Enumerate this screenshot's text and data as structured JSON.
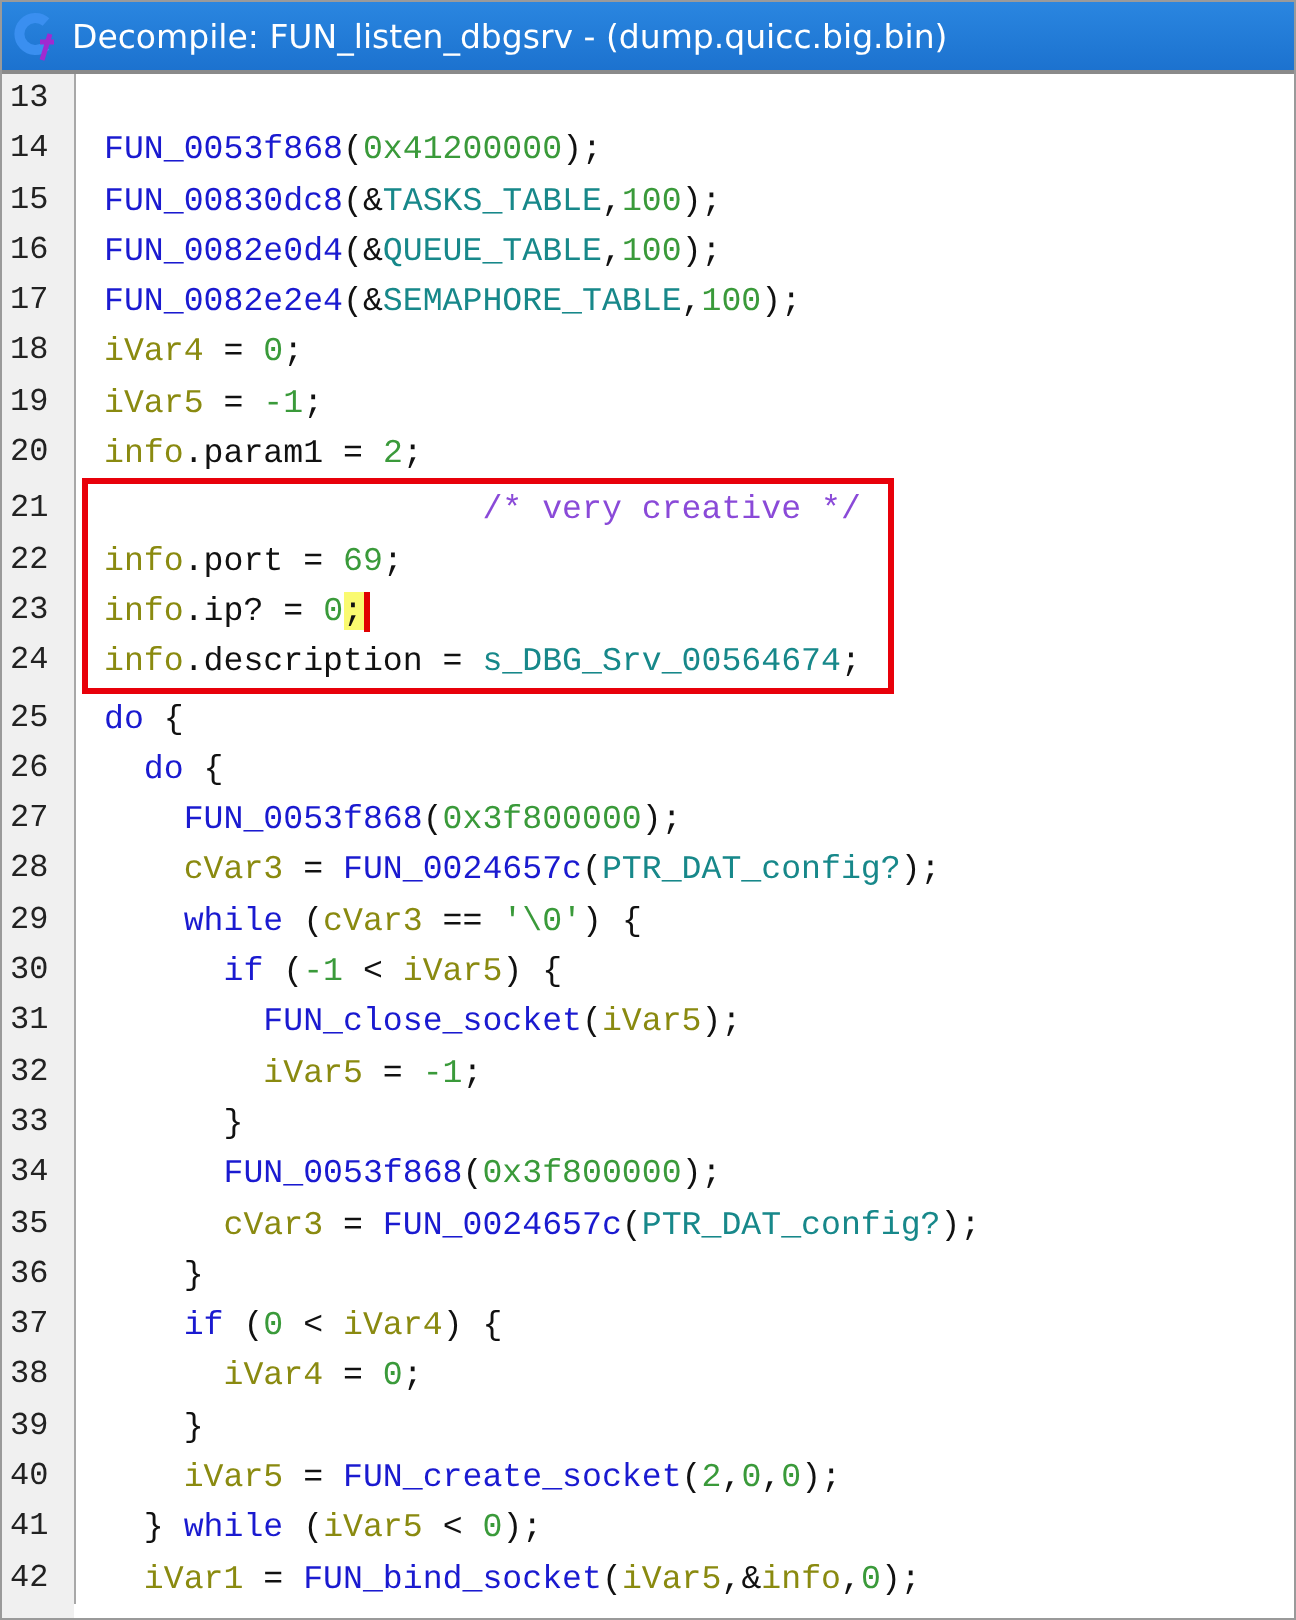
{
  "window": {
    "title": "Decompile: FUN_listen_dbgsrv -  (dump.quicc.big.bin)"
  },
  "lines": [
    {
      "number": "13",
      "boxed": false
    },
    {
      "number": "14",
      "boxed": false,
      "tokens": [
        {
          "kind": "fn",
          "text": "FUN_0053f868"
        },
        {
          "kind": "plain",
          "text": "("
        },
        {
          "kind": "num",
          "text": "0x41200000"
        },
        {
          "kind": "plain",
          "text": ");"
        }
      ]
    },
    {
      "number": "15",
      "boxed": false,
      "tokens": [
        {
          "kind": "fn",
          "text": "FUN_00830dc8"
        },
        {
          "kind": "plain",
          "text": "(&"
        },
        {
          "kind": "global",
          "text": "TASKS_TABLE"
        },
        {
          "kind": "plain",
          "text": ","
        },
        {
          "kind": "num",
          "text": "100"
        },
        {
          "kind": "plain",
          "text": ");"
        }
      ]
    },
    {
      "number": "16",
      "boxed": false,
      "tokens": [
        {
          "kind": "fn",
          "text": "FUN_0082e0d4"
        },
        {
          "kind": "plain",
          "text": "(&"
        },
        {
          "kind": "global",
          "text": "QUEUE_TABLE"
        },
        {
          "kind": "plain",
          "text": ","
        },
        {
          "kind": "num",
          "text": "100"
        },
        {
          "kind": "plain",
          "text": ");"
        }
      ]
    },
    {
      "number": "17",
      "boxed": false,
      "tokens": [
        {
          "kind": "fn",
          "text": "FUN_0082e2e4"
        },
        {
          "kind": "plain",
          "text": "(&"
        },
        {
          "kind": "global",
          "text": "SEMAPHORE_TABLE"
        },
        {
          "kind": "plain",
          "text": ","
        },
        {
          "kind": "num",
          "text": "100"
        },
        {
          "kind": "plain",
          "text": ");"
        }
      ]
    },
    {
      "number": "18",
      "boxed": false,
      "tokens": [
        {
          "kind": "var",
          "text": "iVar4"
        },
        {
          "kind": "plain",
          "text": " = "
        },
        {
          "kind": "num",
          "text": "0"
        },
        {
          "kind": "plain",
          "text": ";"
        }
      ]
    },
    {
      "number": "19",
      "boxed": false,
      "tokens": [
        {
          "kind": "var",
          "text": "iVar5"
        },
        {
          "kind": "plain",
          "text": " = "
        },
        {
          "kind": "num",
          "text": "-1"
        },
        {
          "kind": "plain",
          "text": ";"
        }
      ]
    },
    {
      "number": "20",
      "boxed": false,
      "tokens": [
        {
          "kind": "var",
          "text": "info"
        },
        {
          "kind": "plain",
          "text": ".param1 = "
        },
        {
          "kind": "num",
          "text": "2"
        },
        {
          "kind": "plain",
          "text": ";"
        }
      ]
    },
    {
      "number": "21",
      "boxed": true,
      "tokens": [
        {
          "kind": "comment",
          "text": "                   /* very creative */"
        }
      ]
    },
    {
      "number": "22",
      "boxed": true,
      "tokens": [
        {
          "kind": "var",
          "text": "info"
        },
        {
          "kind": "plain",
          "text": ".port = "
        },
        {
          "kind": "num",
          "text": "69"
        },
        {
          "kind": "plain",
          "text": ";"
        }
      ]
    },
    {
      "number": "23",
      "boxed": true,
      "tokens": [
        {
          "kind": "var",
          "text": "info"
        },
        {
          "kind": "plain",
          "text": ".ip? = "
        },
        {
          "kind": "num",
          "text": "0"
        },
        {
          "kind": "plain",
          "text": ";",
          "cursor": true
        }
      ]
    },
    {
      "number": "24",
      "boxed": true,
      "tokens": [
        {
          "kind": "var",
          "text": "info"
        },
        {
          "kind": "plain",
          "text": ".description = "
        },
        {
          "kind": "global",
          "text": "s_DBG_Srv_00564674"
        },
        {
          "kind": "plain",
          "text": ";"
        }
      ]
    },
    {
      "number": "25",
      "boxed": false,
      "tokens": [
        {
          "kind": "keyword",
          "text": "do"
        },
        {
          "kind": "plain",
          "text": " {"
        }
      ]
    },
    {
      "number": "26",
      "boxed": false,
      "tokens": [
        {
          "kind": "keyword",
          "text": "  do"
        },
        {
          "kind": "plain",
          "text": " {"
        }
      ]
    },
    {
      "number": "27",
      "boxed": false,
      "tokens": [
        {
          "kind": "fn",
          "text": "    FUN_0053f868"
        },
        {
          "kind": "plain",
          "text": "("
        },
        {
          "kind": "num",
          "text": "0x3f800000"
        },
        {
          "kind": "plain",
          "text": ");"
        }
      ]
    },
    {
      "number": "28",
      "boxed": false,
      "tokens": [
        {
          "kind": "var",
          "text": "    cVar3"
        },
        {
          "kind": "plain",
          "text": " = "
        },
        {
          "kind": "fn",
          "text": "FUN_0024657c"
        },
        {
          "kind": "plain",
          "text": "("
        },
        {
          "kind": "global",
          "text": "PTR_DAT_config?"
        },
        {
          "kind": "plain",
          "text": ");"
        }
      ]
    },
    {
      "number": "29",
      "boxed": false,
      "tokens": [
        {
          "kind": "keyword",
          "text": "    while"
        },
        {
          "kind": "plain",
          "text": " ("
        },
        {
          "kind": "var",
          "text": "cVar3"
        },
        {
          "kind": "plain",
          "text": " == "
        },
        {
          "kind": "num",
          "text": "'\\0'"
        },
        {
          "kind": "plain",
          "text": ") {"
        }
      ]
    },
    {
      "number": "30",
      "boxed": false,
      "tokens": [
        {
          "kind": "keyword",
          "text": "      if"
        },
        {
          "kind": "plain",
          "text": " ("
        },
        {
          "kind": "num",
          "text": "-1"
        },
        {
          "kind": "plain",
          "text": " < "
        },
        {
          "kind": "var",
          "text": "iVar5"
        },
        {
          "kind": "plain",
          "text": ") {"
        }
      ]
    },
    {
      "number": "31",
      "boxed": false,
      "tokens": [
        {
          "kind": "fn",
          "text": "        FUN_close_socket"
        },
        {
          "kind": "plain",
          "text": "("
        },
        {
          "kind": "var",
          "text": "iVar5"
        },
        {
          "kind": "plain",
          "text": ");"
        }
      ]
    },
    {
      "number": "32",
      "boxed": false,
      "tokens": [
        {
          "kind": "var",
          "text": "        iVar5"
        },
        {
          "kind": "plain",
          "text": " = "
        },
        {
          "kind": "num",
          "text": "-1"
        },
        {
          "kind": "plain",
          "text": ";"
        }
      ]
    },
    {
      "number": "33",
      "boxed": false,
      "tokens": [
        {
          "kind": "plain",
          "text": "      }"
        }
      ]
    },
    {
      "number": "34",
      "boxed": false,
      "tokens": [
        {
          "kind": "fn",
          "text": "      FUN_0053f868"
        },
        {
          "kind": "plain",
          "text": "("
        },
        {
          "kind": "num",
          "text": "0x3f800000"
        },
        {
          "kind": "plain",
          "text": ");"
        }
      ]
    },
    {
      "number": "35",
      "boxed": false,
      "tokens": [
        {
          "kind": "var",
          "text": "      cVar3"
        },
        {
          "kind": "plain",
          "text": " = "
        },
        {
          "kind": "fn",
          "text": "FUN_0024657c"
        },
        {
          "kind": "plain",
          "text": "("
        },
        {
          "kind": "global",
          "text": "PTR_DAT_config?"
        },
        {
          "kind": "plain",
          "text": ");"
        }
      ]
    },
    {
      "number": "36",
      "boxed": false,
      "tokens": [
        {
          "kind": "plain",
          "text": "    }"
        }
      ]
    },
    {
      "number": "37",
      "boxed": false,
      "tokens": [
        {
          "kind": "keyword",
          "text": "    if"
        },
        {
          "kind": "plain",
          "text": " ("
        },
        {
          "kind": "num",
          "text": "0"
        },
        {
          "kind": "plain",
          "text": " < "
        },
        {
          "kind": "var",
          "text": "iVar4"
        },
        {
          "kind": "plain",
          "text": ") {"
        }
      ]
    },
    {
      "number": "38",
      "boxed": false,
      "tokens": [
        {
          "kind": "var",
          "text": "      iVar4"
        },
        {
          "kind": "plain",
          "text": " = "
        },
        {
          "kind": "num",
          "text": "0"
        },
        {
          "kind": "plain",
          "text": ";"
        }
      ]
    },
    {
      "number": "39",
      "boxed": false,
      "tokens": [
        {
          "kind": "plain",
          "text": "    }"
        }
      ]
    },
    {
      "number": "40",
      "boxed": false,
      "tokens": [
        {
          "kind": "var",
          "text": "    iVar5"
        },
        {
          "kind": "plain",
          "text": " = "
        },
        {
          "kind": "fn",
          "text": "FUN_create_socket"
        },
        {
          "kind": "plain",
          "text": "("
        },
        {
          "kind": "num",
          "text": "2"
        },
        {
          "kind": "plain",
          "text": ","
        },
        {
          "kind": "num",
          "text": "0"
        },
        {
          "kind": "plain",
          "text": ","
        },
        {
          "kind": "num",
          "text": "0"
        },
        {
          "kind": "plain",
          "text": ");"
        }
      ]
    },
    {
      "number": "41",
      "boxed": false,
      "tokens": [
        {
          "kind": "plain",
          "text": "  } "
        },
        {
          "kind": "keyword",
          "text": "while"
        },
        {
          "kind": "plain",
          "text": " ("
        },
        {
          "kind": "var",
          "text": "iVar5"
        },
        {
          "kind": "plain",
          "text": " < "
        },
        {
          "kind": "num",
          "text": "0"
        },
        {
          "kind": "plain",
          "text": ");"
        }
      ]
    },
    {
      "number": "42",
      "boxed": false,
      "tokens": [
        {
          "kind": "var",
          "text": "  iVar1"
        },
        {
          "kind": "plain",
          "text": " = "
        },
        {
          "kind": "fn",
          "text": "FUN_bind_socket"
        },
        {
          "kind": "plain",
          "text": "("
        },
        {
          "kind": "var",
          "text": "iVar5"
        },
        {
          "kind": "plain",
          "text": ",&"
        },
        {
          "kind": "var",
          "text": "info"
        },
        {
          "kind": "plain",
          "text": ","
        },
        {
          "kind": "num",
          "text": "0"
        },
        {
          "kind": "plain",
          "text": ");"
        }
      ]
    }
  ]
}
